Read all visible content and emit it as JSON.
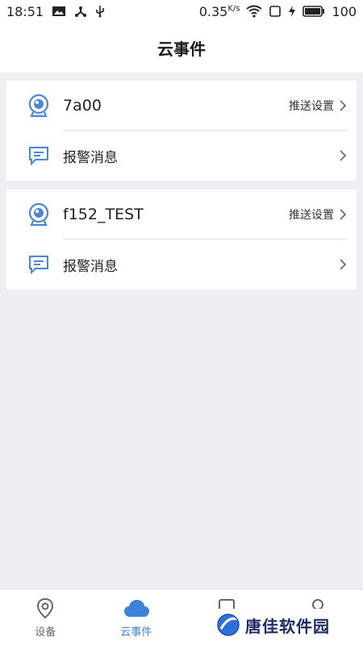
{
  "status_bar": {
    "time": "18:51",
    "net_speed": "0.35",
    "net_unit": "K/s",
    "battery": "100",
    "icons": [
      "image-icon",
      "share-icon",
      "usb-icon",
      "wifi-icon",
      "sim-icon",
      "charging-icon",
      "battery-icon"
    ]
  },
  "header": {
    "title": "云事件"
  },
  "devices": [
    {
      "name": "7a00",
      "push_label": "推送设置",
      "alarm_label": "报警消息"
    },
    {
      "name": "f152_TEST",
      "push_label": "推送设置",
      "alarm_label": "报警消息"
    }
  ],
  "bottom_nav": {
    "items": [
      {
        "label": "设备",
        "icon": "location-pin-icon",
        "active": false
      },
      {
        "label": "云事件",
        "icon": "cloud-icon",
        "active": true
      },
      {
        "label": "",
        "icon": "card-icon",
        "active": false
      },
      {
        "label": "",
        "icon": "person-icon",
        "active": false
      }
    ]
  },
  "watermark": {
    "text": "唐佳软件园"
  },
  "colors": {
    "accent": "#3b82d8",
    "background": "#efeef2",
    "card": "#ffffff",
    "divider": "#e9dbe4"
  }
}
